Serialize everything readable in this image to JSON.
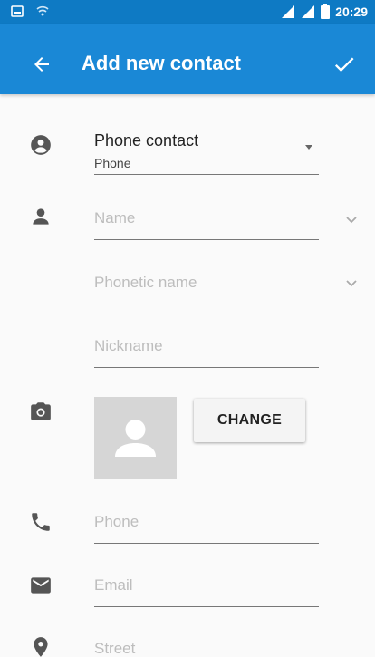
{
  "status_bar": {
    "time": "20:29",
    "icons": [
      "screenshot-icon",
      "wifi-icon",
      "signal-icon",
      "signal-icon",
      "battery-icon"
    ]
  },
  "app_bar": {
    "title": "Add new contact",
    "back_icon": "arrow-left-icon",
    "save_icon": "check-icon",
    "color": "#1a88d6"
  },
  "account": {
    "title": "Phone contact",
    "subtitle": "Phone",
    "icon": "account-circle-icon"
  },
  "fields": {
    "name": "Name",
    "phonetic_name": "Phonetic name",
    "nickname": "Nickname",
    "phone": "Phone",
    "email": "Email",
    "street": "Street"
  },
  "photo": {
    "change_label": "CHANGE",
    "icon": "camera-icon"
  }
}
